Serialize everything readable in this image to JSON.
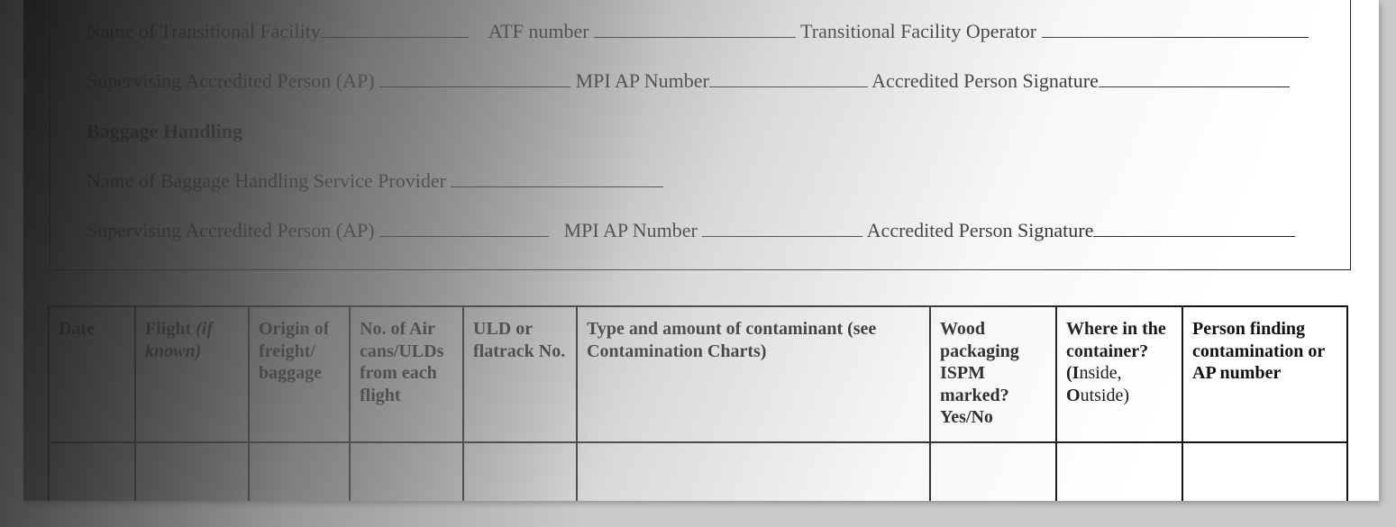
{
  "transitional": {
    "facility_name_label": "Name of Transitional Facility",
    "atf_number_label": "ATF number",
    "operator_label": "Transitional Facility Operator",
    "supervising_ap_label": "Supervising Accredited Person (AP)",
    "mpi_ap_number_label": "MPI AP Number",
    "ap_signature_label": "Accredited Person Signature"
  },
  "baggage": {
    "heading": "Baggage Handling",
    "provider_label": "Name of Baggage Handling Service Provider",
    "supervising_ap_label": "Supervising Accredited Person (AP)",
    "mpi_ap_number_label": "MPI AP Number",
    "ap_signature_label": "Accredited Person Signature"
  },
  "table": {
    "columns": [
      {
        "label": "Date"
      },
      {
        "label": "Flight ",
        "italic": "(if known)"
      },
      {
        "label": "Origin of freight/ baggage"
      },
      {
        "label": "No. of Air cans/ULDs from each flight"
      },
      {
        "label": "ULD or flatrack No."
      },
      {
        "label": "Type and amount of contaminant (see Contamination Charts)"
      },
      {
        "label": "Wood packaging ISPM marked? Yes/No"
      },
      {
        "label_a": "Where in the container? (",
        "cap_i": "I",
        "label_b": "nside, ",
        "cap_o": "O",
        "label_c": "utside)"
      },
      {
        "label": "Person finding contamination or AP number"
      }
    ]
  }
}
